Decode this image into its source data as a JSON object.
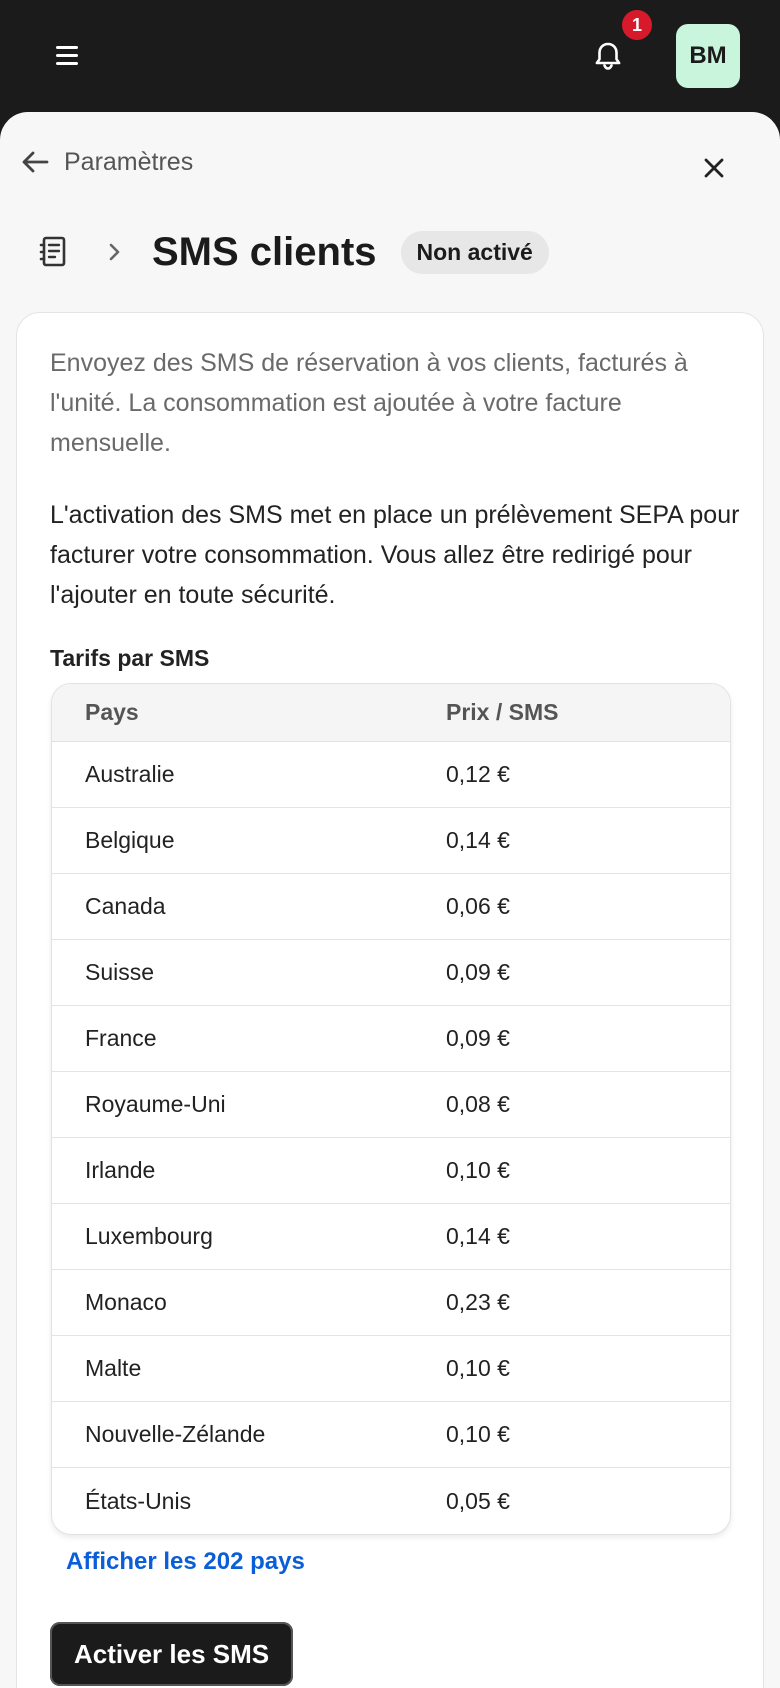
{
  "header": {
    "notification_count": "1",
    "avatar_initials": "BM"
  },
  "nav": {
    "back_label": "Paramètres"
  },
  "page": {
    "title": "SMS clients",
    "status": "Non activé"
  },
  "content": {
    "description": "Envoyez des SMS de réservation à vos clients, facturés à l'unité. La consommation est ajoutée à votre facture mensuelle.",
    "sepa_notice": "L'activation des SMS met en place un prélèvement SEPA pour facturer votre consommation. Vous allez être redirigé pour l'ajouter en toute sécurité.",
    "tarifs_label": "Tarifs par SMS"
  },
  "table": {
    "headers": [
      "Pays",
      "Prix / SMS"
    ],
    "rows": [
      [
        "Australie",
        "0,12 €"
      ],
      [
        "Belgique",
        "0,14 €"
      ],
      [
        "Canada",
        "0,06 €"
      ],
      [
        "Suisse",
        "0,09 €"
      ],
      [
        "France",
        "0,09 €"
      ],
      [
        "Royaume-Uni",
        "0,08 €"
      ],
      [
        "Irlande",
        "0,10 €"
      ],
      [
        "Luxembourg",
        "0,14 €"
      ],
      [
        "Monaco",
        "0,23 €"
      ],
      [
        "Malte",
        "0,10 €"
      ],
      [
        "Nouvelle-Zélande",
        "0,10 €"
      ],
      [
        "États-Unis",
        "0,05 €"
      ]
    ]
  },
  "actions": {
    "show_all_label": "Afficher les 202 pays",
    "activate_label": "Activer les SMS"
  },
  "colors": {
    "topbar": "#1b1b1b",
    "badge": "#d71a2b",
    "avatar_bg": "#c9f5dc",
    "link": "#0a5ed7"
  },
  "icons": [
    "menu-icon",
    "bell-icon",
    "arrow-left-icon",
    "close-icon",
    "document-icon",
    "chevron-right-icon"
  ]
}
